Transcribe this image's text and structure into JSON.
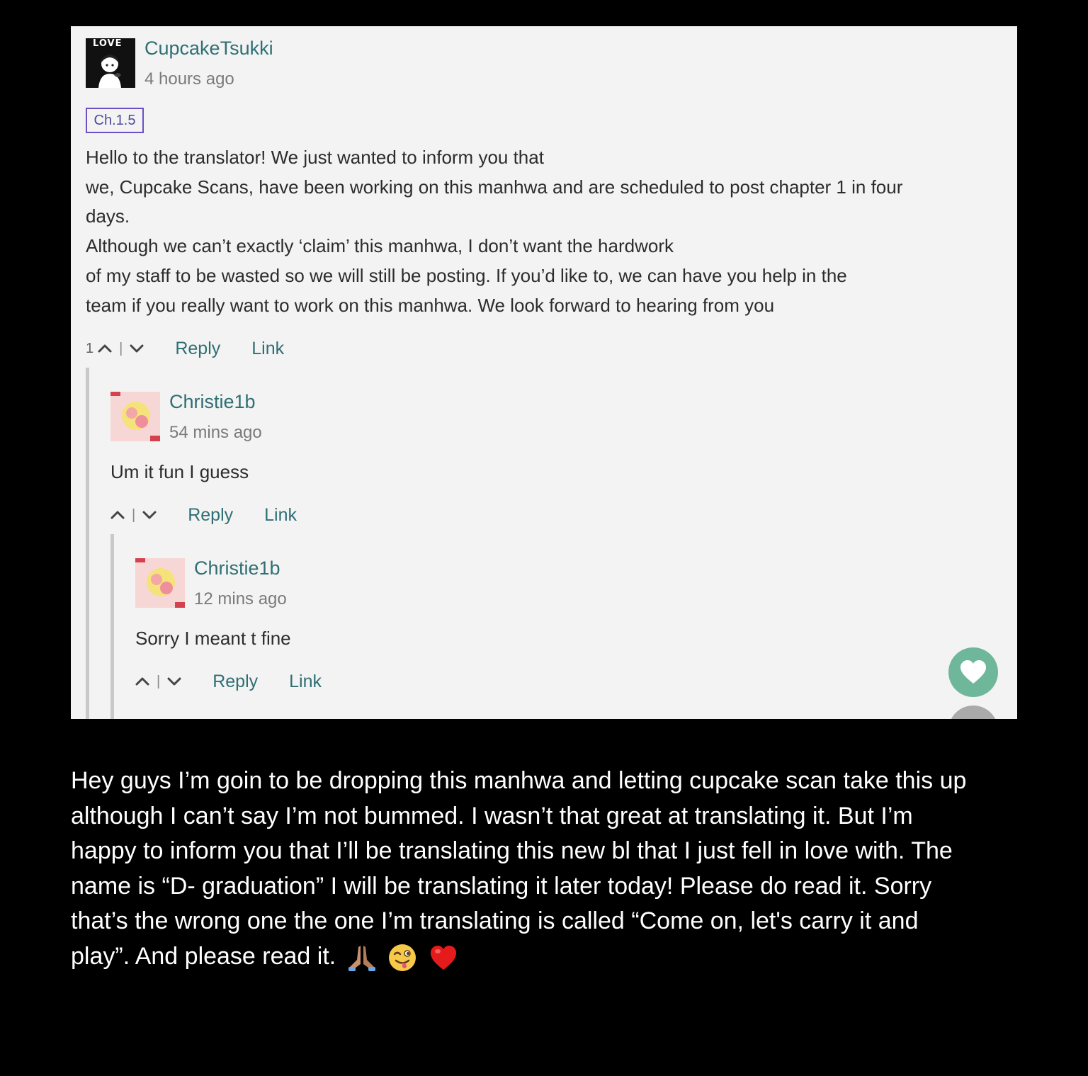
{
  "comment_thread": {
    "top_comment": {
      "avatar_text": "LOVE",
      "username": "CupcakeTsukki",
      "timestamp": "4 hours ago",
      "chapter_tag": "Ch.1.5",
      "body_lines": [
        "Hello to the translator! We just wanted to inform you that",
        "we, Cupcake Scans, have been working on this manhwa and are scheduled to post chapter 1 in four",
        "days.",
        "Although we can’t exactly ‘claim’ this manhwa, I don’t want the hardwork",
        "of my staff to be wasted so we will still be posting. If you’d like to, we can have you help in the",
        "team if you really want to work on this manhwa. We look forward to hearing from you"
      ],
      "vote_count": "1",
      "vote_separator": "|",
      "reply_label": "Reply",
      "link_label": "Link"
    },
    "reply_1": {
      "username": "Christie1b",
      "timestamp": "54 mins ago",
      "body": "Um it fun I guess",
      "vote_separator": "|",
      "reply_label": "Reply",
      "link_label": "Link"
    },
    "reply_2": {
      "username": "Christie1b",
      "timestamp": "12 mins ago",
      "body": "Sorry I meant t fine",
      "vote_separator": "|",
      "reply_label": "Reply",
      "link_label": "Link"
    },
    "accent_color": "#2f6f73",
    "heart_button_color": "#6fb79b",
    "heart_icon": "heart-icon"
  },
  "caption": {
    "lines": [
      "Hey guys I’m goin to be dropping this manhwa and letting cupcake scan take this up",
      "although I can’t say I’m not bummed. I wasn’t that great at translating it. But I’m",
      "happy to inform you that I’ll be translating this new bl that I just fell in love with. The",
      "name is “D- graduation” I will be translating it later today! Please do read it. Sorry",
      "that’s the wrong one the one I’m translating is called “Come on, let's carry it and",
      "play”. And please read it."
    ],
    "emojis": [
      "praying-hands-emoji",
      "winking-tongue-emoji",
      "red-heart-emoji"
    ]
  }
}
